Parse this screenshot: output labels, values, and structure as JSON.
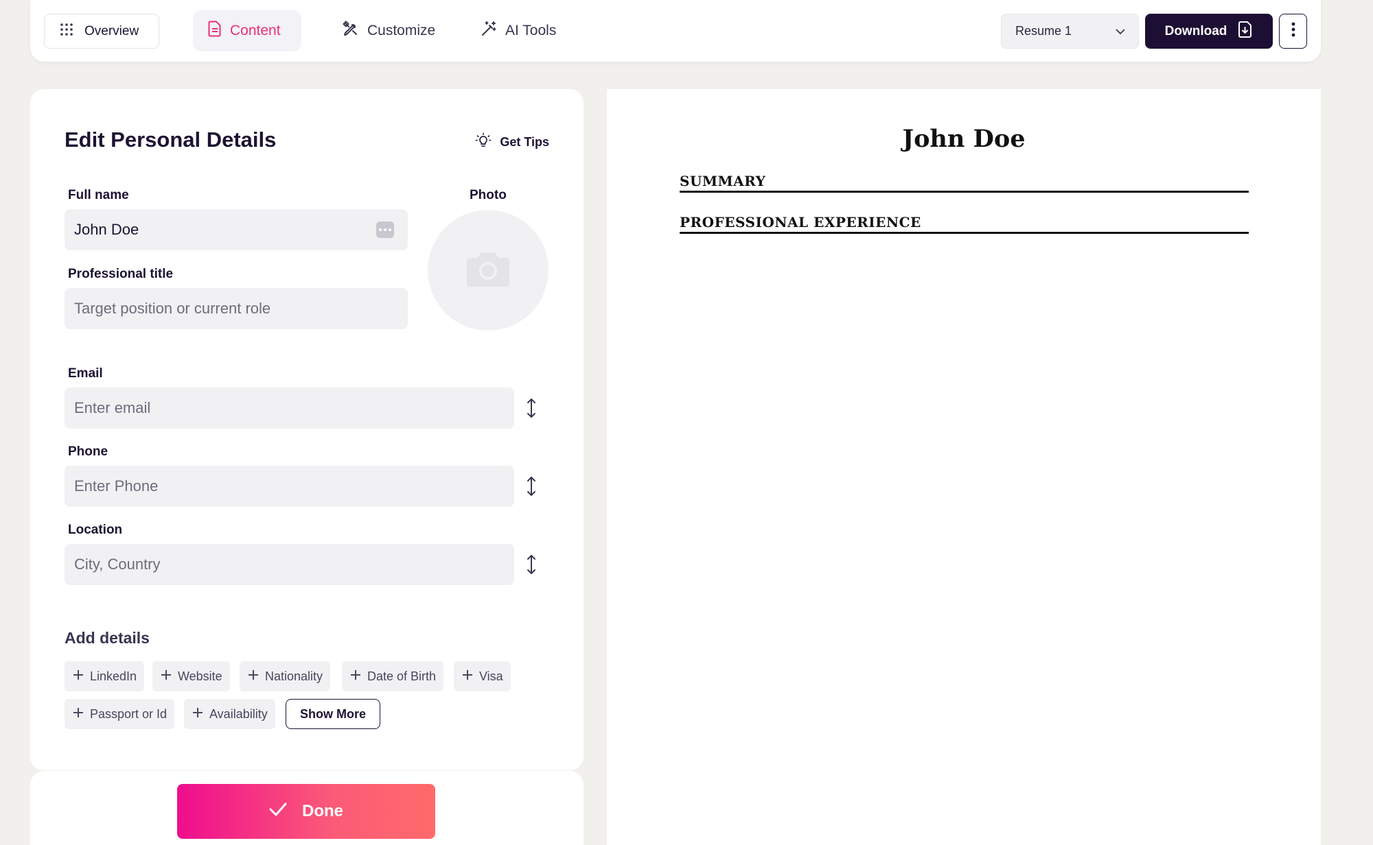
{
  "topbar": {
    "overview_label": "Overview",
    "tabs": [
      {
        "label": "Content",
        "active": true
      },
      {
        "label": "Customize",
        "active": false
      },
      {
        "label": "AI Tools",
        "active": false
      }
    ],
    "resume_select": "Resume 1",
    "download_label": "Download"
  },
  "editor": {
    "title": "Edit Personal Details",
    "get_tips": "Get Tips",
    "full_name": {
      "label": "Full name",
      "value": "John Doe"
    },
    "professional_title": {
      "label": "Professional title",
      "placeholder": "Target position or current role"
    },
    "photo_label": "Photo",
    "email": {
      "label": "Email",
      "placeholder": "Enter email"
    },
    "phone": {
      "label": "Phone",
      "placeholder": "Enter Phone"
    },
    "location": {
      "label": "Location",
      "placeholder": "City, Country"
    },
    "add_details": {
      "title": "Add details",
      "chips": [
        "LinkedIn",
        "Website",
        "Nationality",
        "Date of Birth",
        "Visa",
        "Passport or Id",
        "Availability"
      ],
      "show_more": "Show More"
    },
    "done_label": "Done"
  },
  "preview": {
    "name": "John Doe",
    "sections": [
      "SUMMARY",
      "PROFESSIONAL EXPERIENCE"
    ]
  },
  "colors": {
    "accent": "#ea2f7a",
    "primary_dark": "#1d0f33",
    "done_gradient_start": "#ef0d8e",
    "done_gradient_end": "#ff6a6a",
    "page_background": "#f1f0ec"
  }
}
